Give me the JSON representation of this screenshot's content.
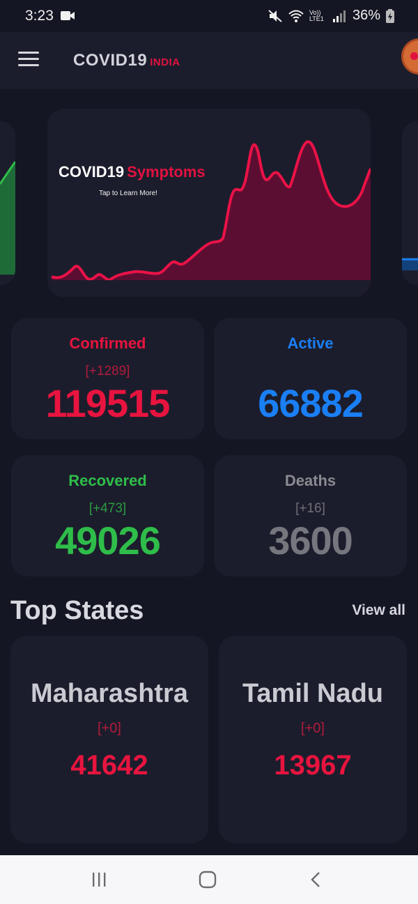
{
  "status_bar": {
    "time": "3:23",
    "battery": "36%",
    "network": "Vo)) LTE1"
  },
  "app_bar": {
    "title": "COVID19",
    "title_accent": "INDIA",
    "menu_icon": "hamburger-menu-icon",
    "accent_color": "#e01240"
  },
  "carousel": {
    "active_card": {
      "title": "COVID19",
      "title_accent": "Symptoms",
      "subtitle": "Tap to Learn More!"
    }
  },
  "stats": {
    "confirmed": {
      "label": "Confirmed",
      "delta": "[+1289]",
      "value": "119515",
      "color": "#e8143f"
    },
    "active": {
      "label": "Active",
      "delta": "",
      "value": "66882",
      "color": "#1a7ff5"
    },
    "recovered": {
      "label": "Recovered",
      "delta": "[+473]",
      "value": "49026",
      "color": "#2fbd4a"
    },
    "deaths": {
      "label": "Deaths",
      "delta": "[+16]",
      "value": "3600",
      "color": "#76777e"
    }
  },
  "top_states": {
    "title": "Top States",
    "view_all": "View all",
    "items": [
      {
        "name": "Maharashtra",
        "delta": "[+0]",
        "value": "41642"
      },
      {
        "name": "Tamil Nadu",
        "delta": "[+0]",
        "value": "13967"
      }
    ]
  },
  "nav_bar": {
    "buttons": [
      "recent-apps-icon",
      "home-icon",
      "back-icon"
    ]
  }
}
